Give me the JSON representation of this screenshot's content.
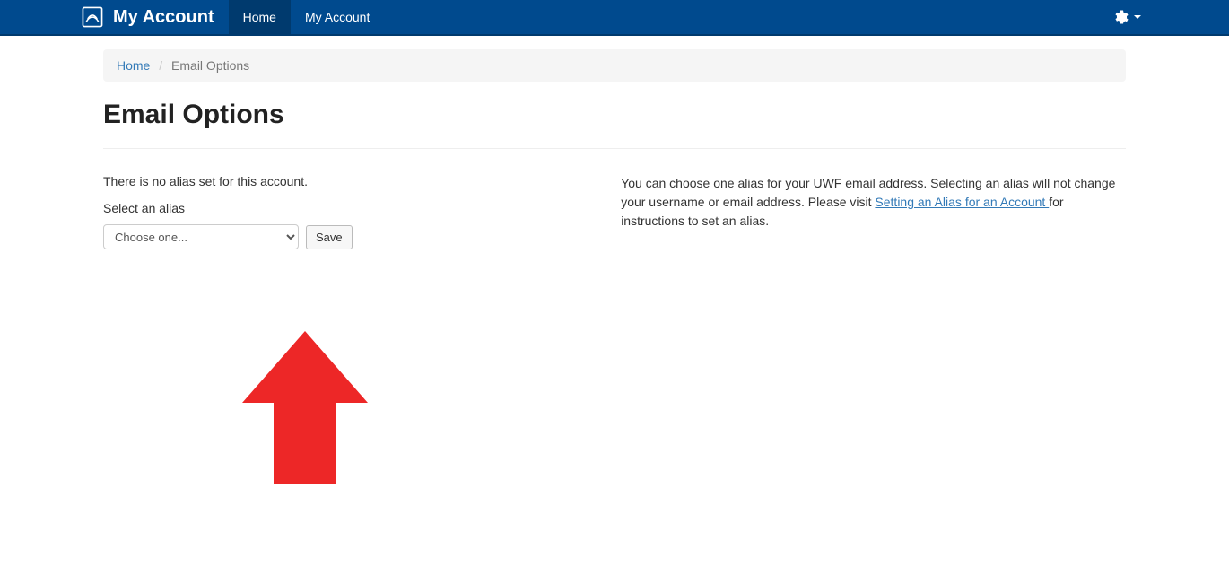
{
  "navbar": {
    "brand": "My Account",
    "items": [
      {
        "label": "Home",
        "active": true
      },
      {
        "label": "My Account",
        "active": false
      }
    ]
  },
  "breadcrumb": {
    "home": "Home",
    "current": "Email Options"
  },
  "page": {
    "title": "Email Options"
  },
  "left": {
    "status": "There is no alias set for this account.",
    "label": "Select an alias",
    "select_placeholder": "Choose one...",
    "save_label": "Save"
  },
  "right": {
    "text_before_link": "You can choose one alias for your UWF email address. Selecting an alias will not change your username or email address. Please visit ",
    "link_text": "Setting an Alias for an Account ",
    "text_after_link": "for instructions to set an alias."
  }
}
